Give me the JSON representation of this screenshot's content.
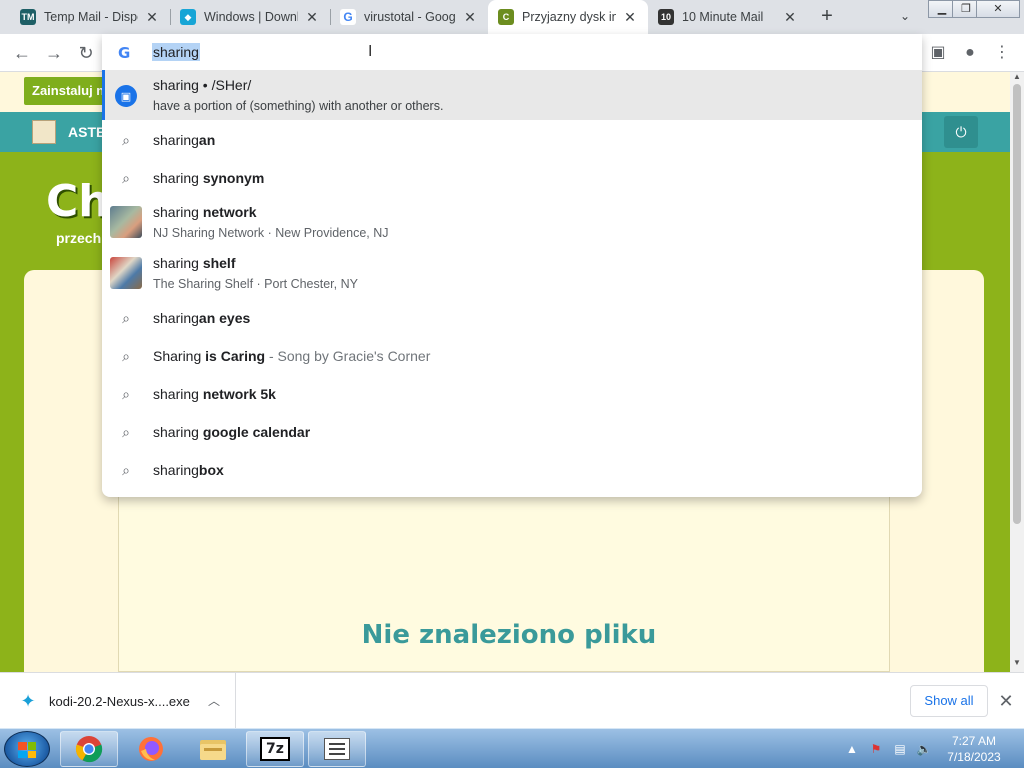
{
  "tabs": [
    {
      "title": "Temp Mail - Dispo",
      "icon": "tempmail-icon",
      "color": "#1e5f66",
      "glyph": "TM"
    },
    {
      "title": "Windows | Downl",
      "icon": "kodi-icon",
      "color": "#17a5d6",
      "glyph": "K"
    },
    {
      "title": "virustotal - Googl",
      "icon": "google-icon",
      "color": "#ffffff",
      "glyph": "G"
    },
    {
      "title": "Przyjazny dysk int",
      "icon": "chomikuj-icon",
      "color": "#6c8d1f",
      "glyph": "C"
    },
    {
      "title": "10 Minute Mail",
      "icon": "tenminutemail-icon",
      "color": "#333333",
      "glyph": "10"
    }
  ],
  "omnibox": {
    "query": "sharing",
    "suggestions": [
      {
        "type": "definition",
        "line1_a": "sharing • /SHer/",
        "line1_b": "",
        "line2": "have a portion of (something) with another or others."
      },
      {
        "type": "search",
        "plain": "sharing",
        "bold": "an",
        "extra": ""
      },
      {
        "type": "search",
        "plain": "sharing ",
        "bold": "synonym",
        "extra": ""
      },
      {
        "type": "place",
        "plain": "sharing ",
        "bold": "network",
        "line2": "NJ Sharing Network · New Providence, NJ"
      },
      {
        "type": "place",
        "plain": "sharing ",
        "bold": "shelf",
        "line2": "The Sharing Shelf · Port Chester, NY"
      },
      {
        "type": "search",
        "plain": "sharing",
        "bold": "an eyes",
        "extra": ""
      },
      {
        "type": "search",
        "plain": "Sharing ",
        "bold": "is Caring",
        "extra": " - Song by Gracie's Corner"
      },
      {
        "type": "search",
        "plain": "sharing ",
        "bold": "network 5k",
        "extra": ""
      },
      {
        "type": "search",
        "plain": "sharing ",
        "bold": "google calendar",
        "extra": ""
      },
      {
        "type": "search",
        "plain": "sharing",
        "bold": "box",
        "extra": ""
      }
    ]
  },
  "page": {
    "install_label": "Zainstaluj n",
    "nav_text": "ASTE",
    "big_title": "Ch",
    "subtitle": "przech",
    "not_found": "Nie znaleziono pliku"
  },
  "downloads": {
    "filename": "kodi-20.2-Nexus-x....exe",
    "show_all": "Show all"
  },
  "taskbar": {
    "time": "7:27 AM",
    "date": "7/18/2023"
  }
}
